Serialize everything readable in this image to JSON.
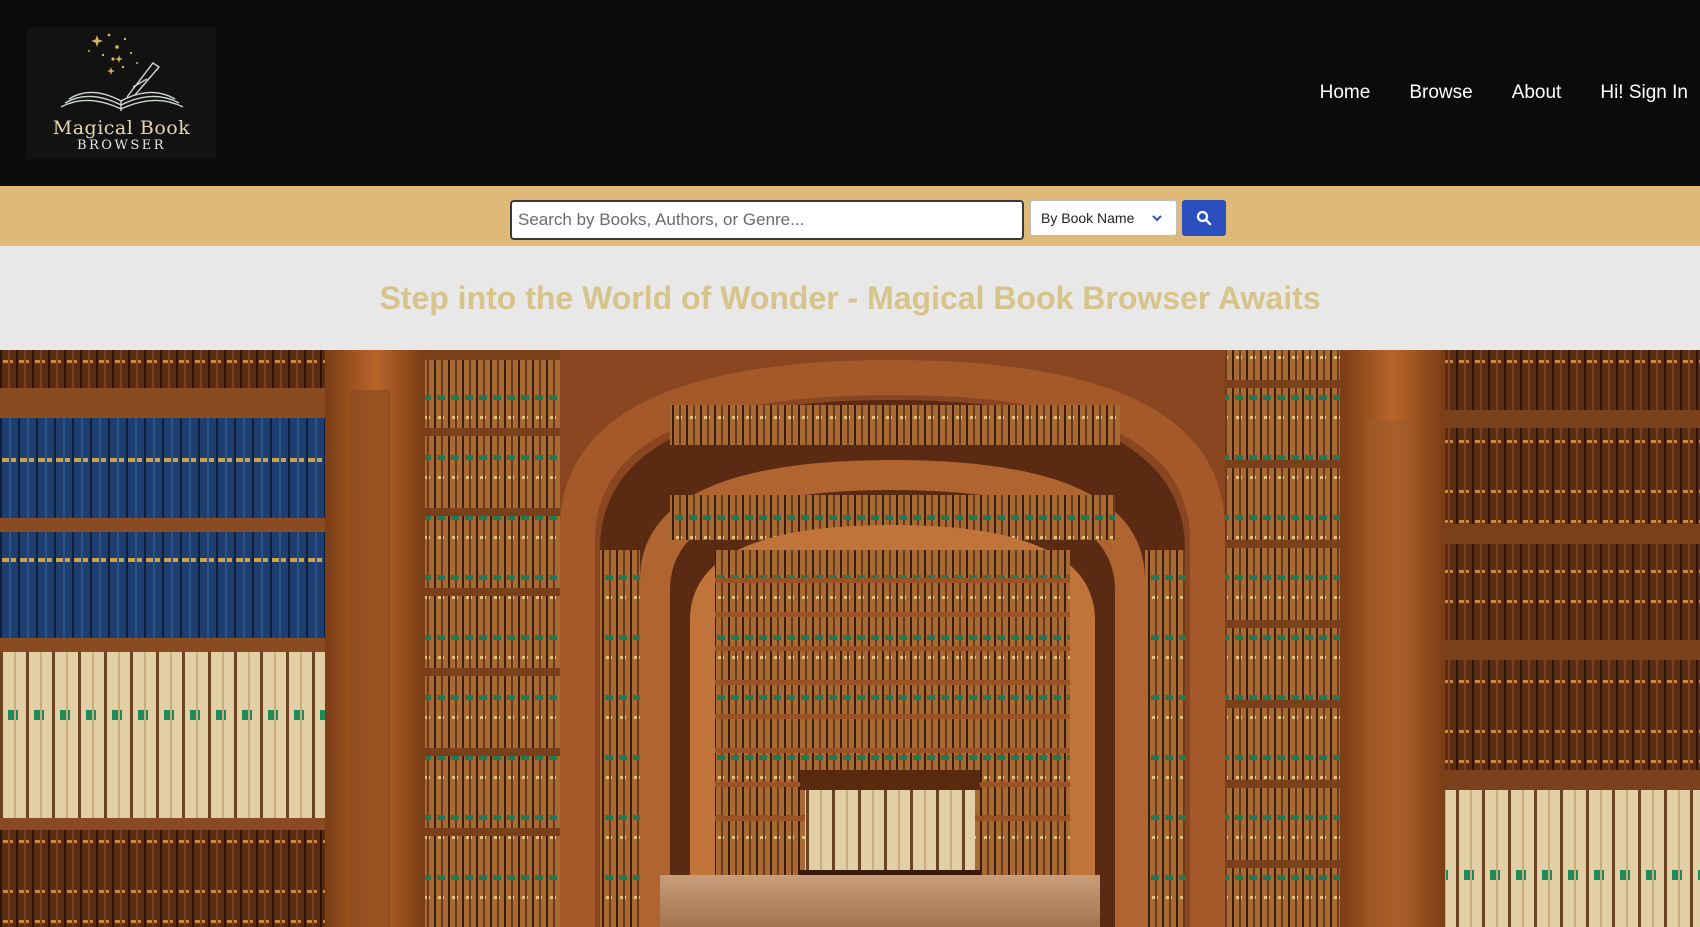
{
  "brand": {
    "title": "Magical Book",
    "subtitle": "BROWSER"
  },
  "nav": {
    "items": [
      "Home",
      "Browse",
      "About",
      "Hi! Sign In"
    ]
  },
  "search": {
    "placeholder": "Search by Books, Authors, or Genre...",
    "value": "",
    "mode_selected": "By Book Name",
    "button_icon": "search-icon"
  },
  "tagline": "Step into the World of Wonder - Magical Book Browser Awaits",
  "hero": {
    "image": "library-hero-image"
  },
  "colors": {
    "topbar": "#0b0b0c",
    "search_strip": "#dfb978",
    "tagline_band": "#e8e8e8",
    "tagline_text": "#d6c48a",
    "search_button": "#2c4fbf"
  }
}
